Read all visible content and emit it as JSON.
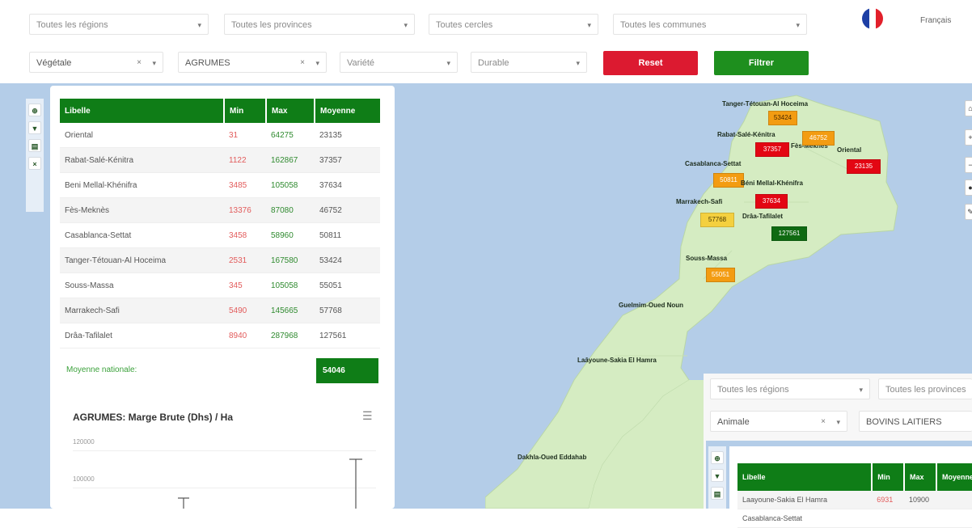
{
  "filters_row1": [
    {
      "placeholder": "Toutes les régions"
    },
    {
      "placeholder": "Toutes les provinces"
    },
    {
      "placeholder": "Toutes cercles"
    },
    {
      "placeholder": "Toutes les communes"
    }
  ],
  "language": {
    "label": "Français"
  },
  "filters_row2": [
    {
      "value": "Végétale"
    },
    {
      "value": "AGRUMES"
    },
    {
      "placeholder": "Variété"
    },
    {
      "placeholder": "Durable"
    }
  ],
  "buttons": {
    "reset": "Reset",
    "filter": "Filtrer"
  },
  "colors": {
    "green": "#0f7d17",
    "red": "#dc1a30",
    "orange": "#f39c12",
    "yellow": "#f4d03f",
    "dark_red": "#e30613"
  },
  "main_table": {
    "headers": [
      "Libelle",
      "Min",
      "Max",
      "Moyenne"
    ],
    "rows": [
      [
        "Oriental",
        "31",
        "64275",
        "23135"
      ],
      [
        "Rabat-Salé-Kénitra",
        "1122",
        "162867",
        "37357"
      ],
      [
        "Beni Mellal-Khénifra",
        "3485",
        "105058",
        "37634"
      ],
      [
        "Fès-Meknès",
        "13376",
        "87080",
        "46752"
      ],
      [
        "Casablanca-Settat",
        "3458",
        "58960",
        "50811"
      ],
      [
        "Tanger-Tétouan-Al Hoceima",
        "2531",
        "167580",
        "53424"
      ],
      [
        "Souss-Massa",
        "345",
        "105058",
        "55051"
      ],
      [
        "Marrakech-Safi",
        "5490",
        "145665",
        "57768"
      ],
      [
        "Drâa-Tafilalet",
        "8940",
        "287968",
        "127561"
      ]
    ],
    "average_label": "Moyenne nationale:",
    "average_value": "54046"
  },
  "chart": {
    "title": "AGRUMES: Marge Brute (Dhs) / Ha",
    "menu_icon": "hamburger-icon",
    "yticks": [
      "120000",
      "100000"
    ]
  },
  "map": {
    "regions": [
      {
        "name": "Tanger-Tétouan-Al Hoceima",
        "value": "53424",
        "color": "orange"
      },
      {
        "name": "Rabat-Salé-Kénitra",
        "value": "37357",
        "color": "dark_red"
      },
      {
        "name": "Fès-Meknès",
        "value": "46752",
        "color": "orange"
      },
      {
        "name": "Oriental",
        "value": "23135",
        "color": "dark_red"
      },
      {
        "name": "Casablanca-Settat",
        "value": "50811",
        "color": "orange"
      },
      {
        "name": "Béni Mellal-Khénifra",
        "value": "37634",
        "color": "dark_red"
      },
      {
        "name": "Marrakech-Safi",
        "value": "57768",
        "color": "yellow"
      },
      {
        "name": "Drâa-Tafilalet",
        "value": "127561",
        "color": "green"
      },
      {
        "name": "Souss-Massa",
        "value": "55051",
        "color": "orange"
      },
      {
        "name": "Guelmim-Oued Noun",
        "value": "",
        "color": ""
      },
      {
        "name": "Laâyoune-Sakia El Hamra",
        "value": "",
        "color": ""
      },
      {
        "name": "Dakhla-Oued Eddahab",
        "value": "",
        "color": ""
      }
    ]
  },
  "second_panel": {
    "filters": [
      {
        "placeholder": "Toutes les régions"
      },
      {
        "placeholder": "Toutes les provinces"
      },
      {
        "value": "Animale"
      },
      {
        "value": "BOVINS LAITIERS"
      }
    ],
    "table_headers": [
      "Libelle",
      "Min",
      "Max",
      "Moyenne"
    ],
    "rows": [
      [
        "Laayoune-Sakia El Hamra",
        "6931",
        "10900",
        ""
      ],
      [
        "Casablanca-Settat",
        "",
        "",
        ""
      ]
    ]
  }
}
